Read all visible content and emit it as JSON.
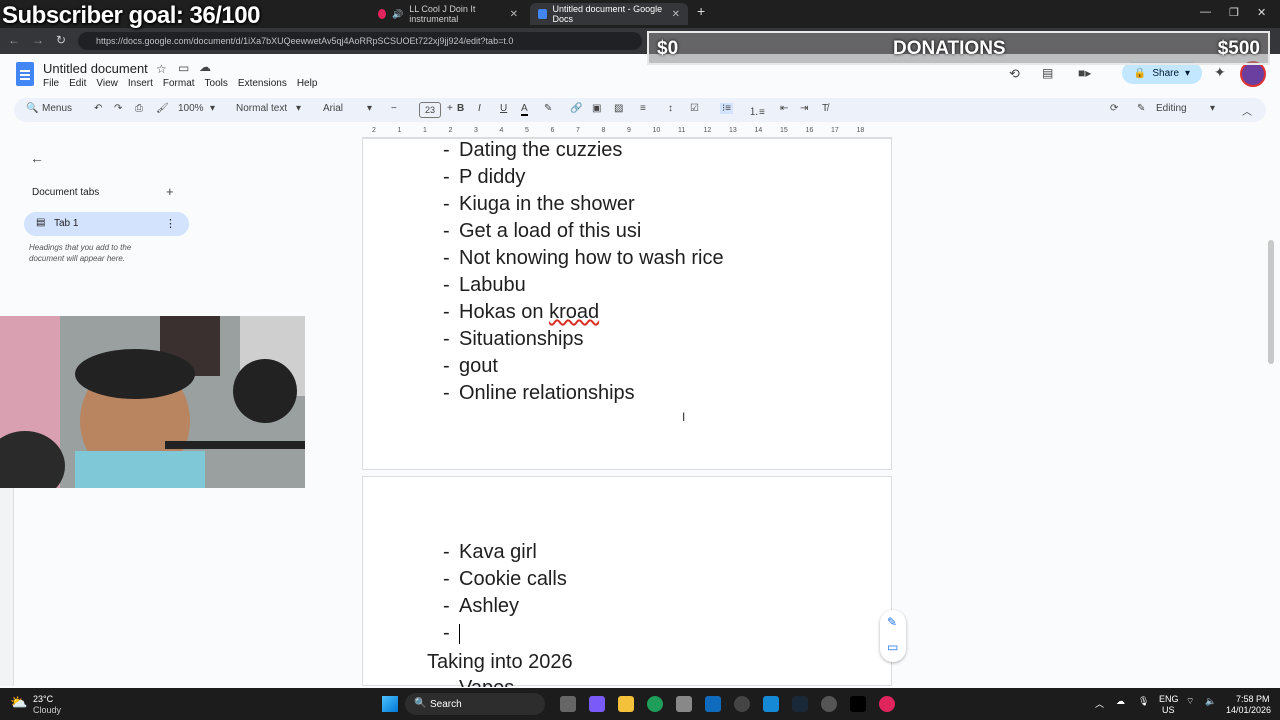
{
  "overlay": {
    "subscriber_goal": "Subscriber goal: 36/100",
    "donation_current": "$0",
    "donation_label": "DONATIONS",
    "donation_goal": "$500"
  },
  "browser": {
    "tabs": [
      {
        "label": "LL Cool J Doin It instrumental"
      },
      {
        "label": "Untitled document - Google Docs"
      }
    ],
    "url": "https://docs.google.com/document/d/1iXa7bXUQeewwetAv5qj4AoRRpSCSUOEt722xj9jj924/edit?tab=t.0"
  },
  "docs": {
    "title": "Untitled document",
    "menu": [
      "File",
      "Edit",
      "View",
      "Insert",
      "Format",
      "Tools",
      "Extensions",
      "Help"
    ],
    "share_label": "Share",
    "toolbar": {
      "menus_label": "Menus",
      "zoom": "100%",
      "style": "Normal text",
      "font": "Arial",
      "font_size": "23",
      "mode": "Editing"
    },
    "ruler_marks": [
      "2",
      "1",
      "1",
      "2",
      "3",
      "4",
      "5",
      "6",
      "7",
      "8",
      "9",
      "10",
      "11",
      "12",
      "13",
      "14",
      "15",
      "16",
      "17",
      "18"
    ]
  },
  "sidebar": {
    "section_title": "Document tabs",
    "tab_label": "Tab 1",
    "hint": "Headings that you add to the document will appear here."
  },
  "page1": {
    "items": [
      "Dating the cuzzies",
      "P diddy",
      "Kiuga in the shower",
      "Get a load of this usi",
      "Not knowing how to wash rice",
      "Labubu",
      "Hokas on kroad",
      "Situationships",
      "gout",
      "Online relationships"
    ]
  },
  "page2": {
    "items": [
      "Kava girl",
      "Cookie calls",
      "Ashley",
      ""
    ],
    "heading": "Taking into 2026",
    "partial_item": "Vapes"
  },
  "taskbar": {
    "weather_temp": "23°C",
    "weather_desc": "Cloudy",
    "search_label": "Search",
    "lang": "ENG",
    "region": "US",
    "time": "7:58 PM",
    "date": "14/01/2026"
  },
  "colors": {
    "accent": "#1a73e8",
    "share_bg": "#c2e7ff",
    "tab_active": "#d3e3fd",
    "spell_underline": "#d93025"
  },
  "icons": [
    "undo-icon",
    "redo-icon",
    "print-icon",
    "paint-format-icon",
    "bold-icon",
    "italic-icon",
    "underline-icon",
    "text-color-icon",
    "highlight-icon",
    "link-icon",
    "comment-icon",
    "image-icon",
    "align-icon",
    "line-spacing-icon",
    "checklist-icon",
    "bullet-list-icon",
    "numbered-list-icon",
    "indent-icon",
    "clear-format-icon",
    "history-icon",
    "comments-icon",
    "meet-icon",
    "gemini-icon",
    "star-icon",
    "folder-icon",
    "cloud-icon"
  ]
}
